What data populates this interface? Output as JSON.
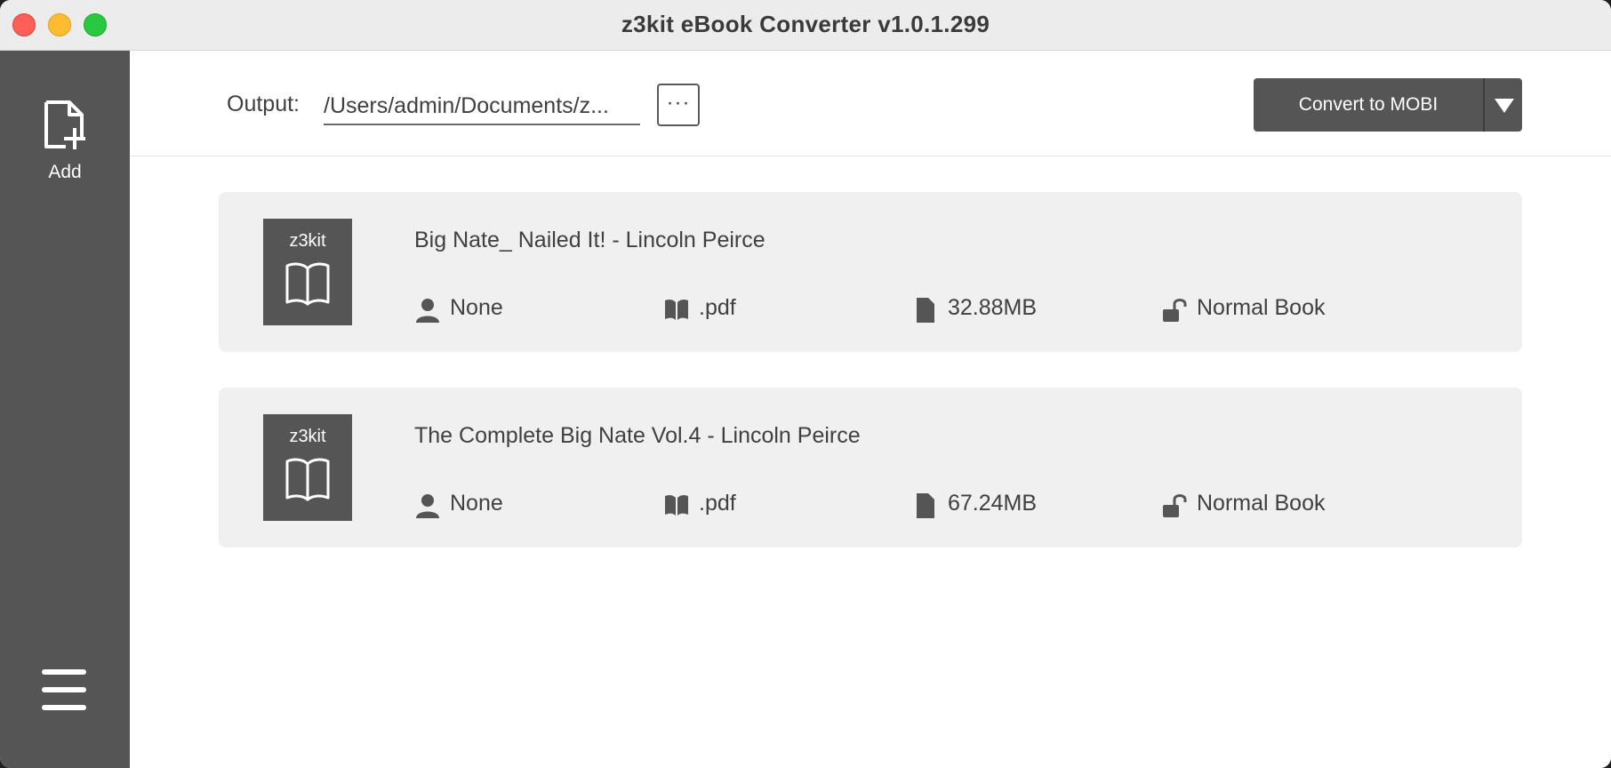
{
  "window": {
    "title": "z3kit eBook Converter v1.0.1.299"
  },
  "sidebar": {
    "add_label": "Add",
    "add_icon": "add-file-icon",
    "menu_icon": "hamburger-menu-icon"
  },
  "toolbar": {
    "output_label": "Output:",
    "output_path": "/Users/admin/Documents/z...",
    "browse_label": "···",
    "convert_label": "Convert to MOBI",
    "convert_dropdown_icon": "triangle-down-icon"
  },
  "books": [
    {
      "cover_text": "z3kit",
      "title": "Big Nate_ Nailed It! - Lincoln Peirce",
      "author": "None",
      "format": ".pdf",
      "size": "32.88MB",
      "status": "Normal Book"
    },
    {
      "cover_text": "z3kit",
      "title": "The Complete Big Nate Vol.4 - Lincoln Peirce",
      "author": "None",
      "format": ".pdf",
      "size": "67.24MB",
      "status": "Normal Book"
    }
  ],
  "colors": {
    "sidebar": "#555555",
    "card": "#f0f0f0",
    "text": "#404040",
    "close": "#fe5f57",
    "minimize": "#febc2e",
    "maximize": "#28c840"
  }
}
